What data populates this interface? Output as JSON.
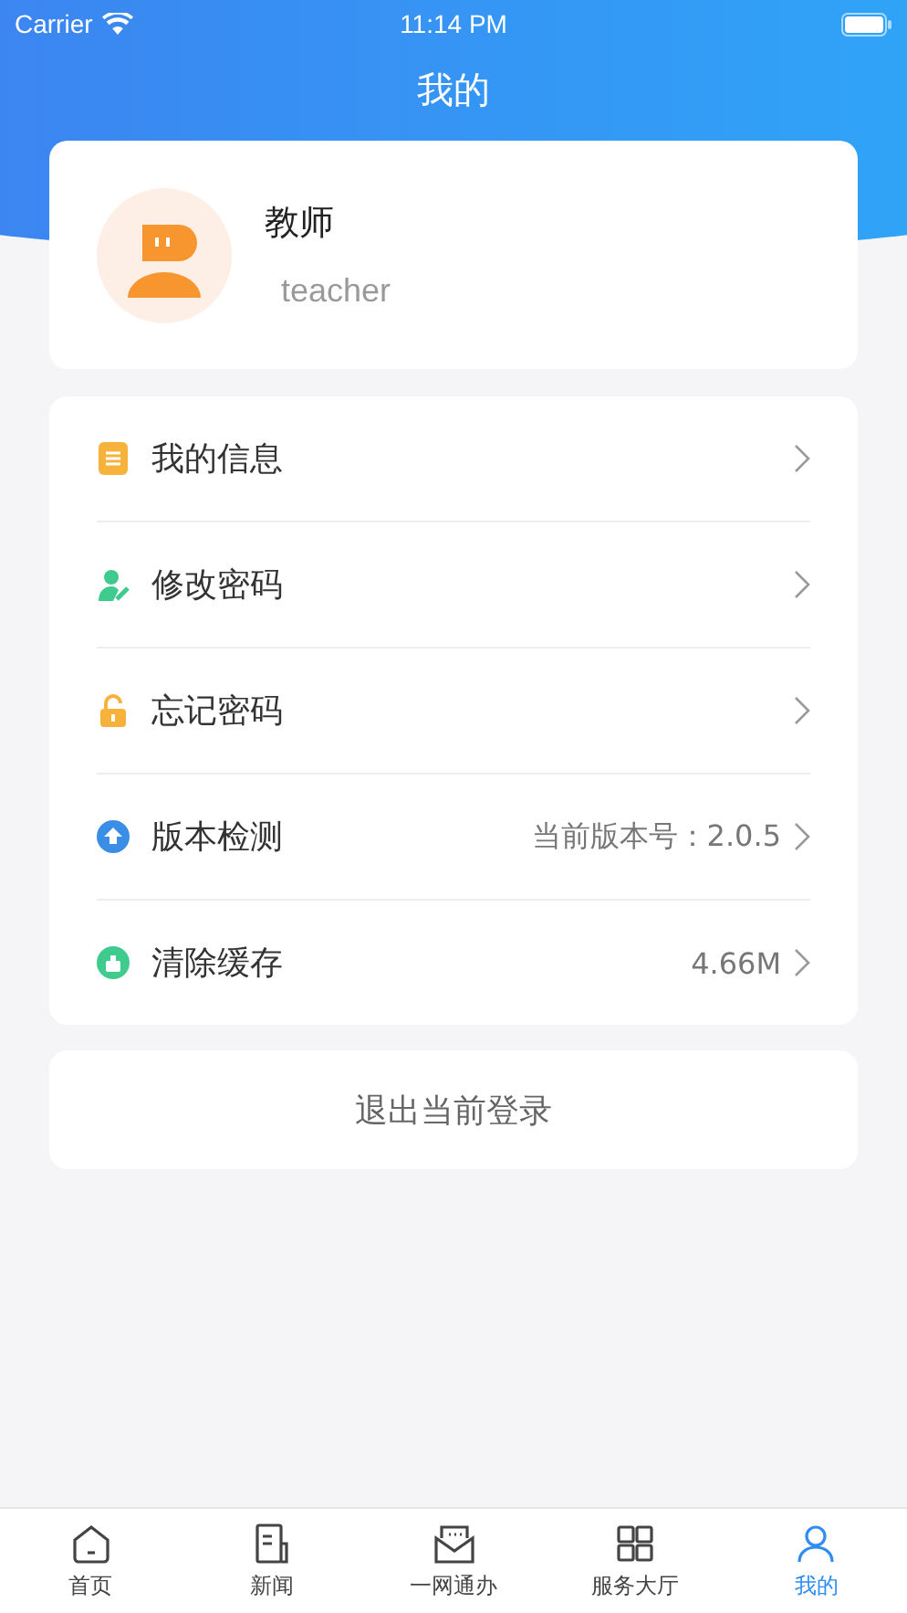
{
  "status_bar": {
    "carrier": "Carrier",
    "time": "11:14 PM"
  },
  "header": {
    "title": "我的"
  },
  "profile": {
    "name": "教师",
    "role": "teacher"
  },
  "menu": [
    {
      "kind": "info",
      "label": "我的信息"
    },
    {
      "kind": "password",
      "label": "修改密码"
    },
    {
      "kind": "forgot",
      "label": "忘记密码"
    },
    {
      "kind": "version",
      "label": "版本检测",
      "value": "当前版本号：2.0.5"
    },
    {
      "kind": "cache",
      "label": "清除缓存",
      "value": "4.66M"
    }
  ],
  "logout_button": "退出当前登录",
  "tabs": [
    {
      "kind": "home",
      "label": "首页",
      "selected": false
    },
    {
      "kind": "news",
      "label": "新闻",
      "selected": false
    },
    {
      "kind": "mail",
      "label": "一网通办",
      "selected": false
    },
    {
      "kind": "service",
      "label": "服务大厅",
      "selected": false
    },
    {
      "kind": "me",
      "label": "我的",
      "selected": true
    }
  ]
}
